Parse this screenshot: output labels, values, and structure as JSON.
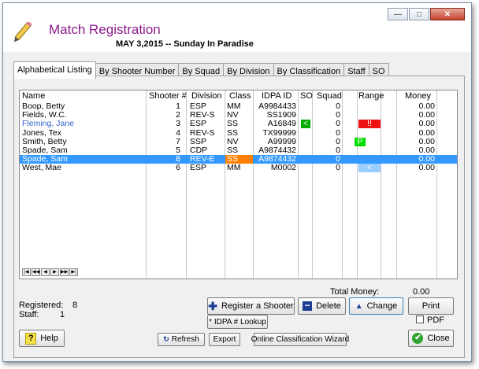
{
  "window": {
    "title": "Match Registration",
    "subtitle": "MAY  3,2015 -- Sunday In Paradise",
    "minimize": "—",
    "maximize": "□",
    "close": "✕"
  },
  "tabs": [
    "Alphabetical Listing",
    "By Shooter Number",
    "By Squad",
    "By Division",
    "By Classification",
    "Staff",
    "SO"
  ],
  "grid": {
    "headers": {
      "name": "Name",
      "shooter": "Shooter #",
      "division": "Division",
      "class": "Class",
      "idpa": "IDPA ID",
      "so": "SO",
      "squad": "Squad",
      "range": "Range",
      "money": "Money"
    },
    "rows": [
      {
        "name": "Boop, Betty",
        "shooter": "1",
        "division": "ESP",
        "class": "MM",
        "idpa": "A9984433",
        "so": "",
        "squad": "0",
        "range": "",
        "money": "0.00"
      },
      {
        "name": "Fields, W.C.",
        "shooter": "2",
        "division": "REV-S",
        "class": "NV",
        "idpa": "SS1909",
        "so": "",
        "squad": "0",
        "range": "",
        "money": "0.00"
      },
      {
        "name": "Fleming, Jane",
        "shooter": "3",
        "division": "ESP",
        "class": "SS",
        "idpa": "A16849",
        "so": "<",
        "squad": "0",
        "range": "!!",
        "money": "0.00"
      },
      {
        "name": "Jones, Tex",
        "shooter": "4",
        "division": "REV-S",
        "class": "SS",
        "idpa": "TX99999",
        "so": "",
        "squad": "0",
        "range": "",
        "money": "0.00"
      },
      {
        "name": "Smith, Betty",
        "shooter": "7",
        "division": "SSP",
        "class": "NV",
        "idpa": "A99999",
        "so": "",
        "squad": "0",
        "range": "P",
        "money": "0.00"
      },
      {
        "name": "Spade, Sam",
        "shooter": "5",
        "division": "CDP",
        "class": "SS",
        "idpa": "A9874432",
        "so": "",
        "squad": "0",
        "range": "",
        "money": "0.00"
      },
      {
        "name": "Spade, Sam",
        "shooter": "8",
        "division": "REV-E",
        "class": "SS",
        "idpa": "A9874432",
        "so": "",
        "squad": "0",
        "range": "",
        "money": "0.00"
      },
      {
        "name": "West, Mae",
        "shooter": "6",
        "division": "ESP",
        "class": "MM",
        "idpa": "M0002",
        "so": "",
        "squad": "0",
        "range": "<",
        "money": "0.00"
      }
    ]
  },
  "nav": [
    "|◀",
    "◀◀",
    "◀",
    "▶",
    "▶▶",
    "▶|"
  ],
  "stats": {
    "registered_label": "Registered:",
    "registered_value": "8",
    "staff_label": "Staff:",
    "staff_value": "1",
    "total_money_label": "Total Money:",
    "total_money_value": "0.00"
  },
  "buttons": {
    "register": "Register a Shooter",
    "delete": "Delete",
    "change": "Change",
    "print": "Print",
    "pdf": "PDF",
    "idpa_lookup": "* IDPA # Lookup",
    "help": "Help",
    "refresh": "Refresh",
    "export": "Export",
    "online": "Online Classification Wizard",
    "close": "Close"
  },
  "colors": {
    "selection": "#3399ff",
    "so_green": "#00aa00",
    "range_red": "#ee1111",
    "range_green": "#00dd00",
    "range_lightblue": "#99ccff",
    "class_orange": "#ff8000",
    "title_purple": "#8b1a8b"
  }
}
